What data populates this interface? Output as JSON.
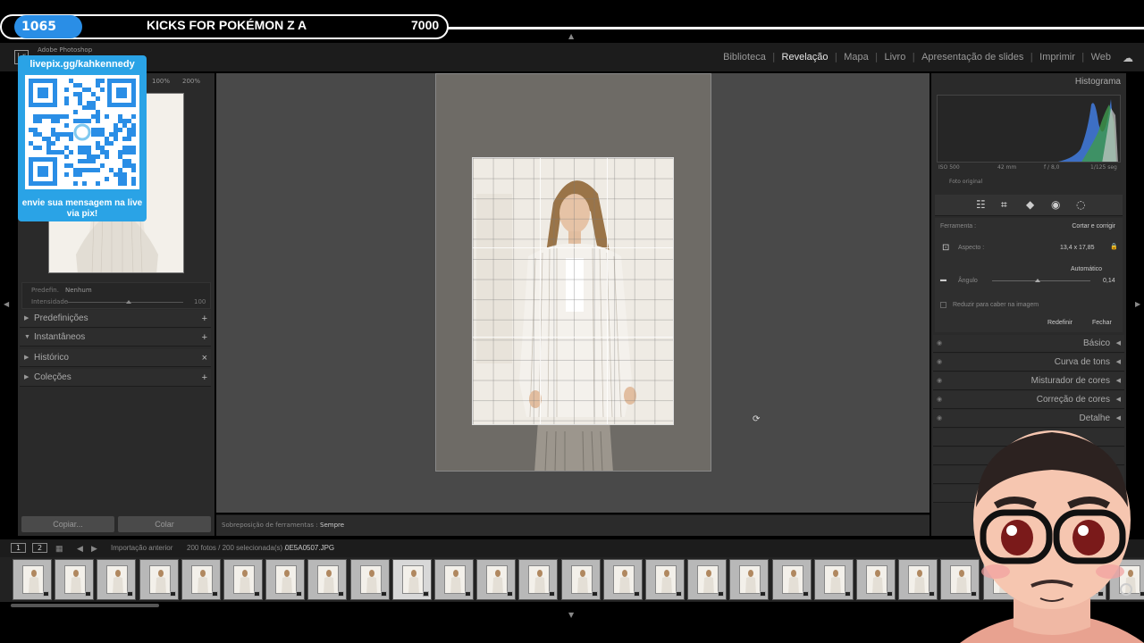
{
  "stream": {
    "count": "1065",
    "title": "KICKS FOR POKÉMON Z A",
    "value": "7000"
  },
  "app": {
    "name": "Adobe Photoshop",
    "logo": "Lr"
  },
  "modules": [
    "Biblioteca",
    "Revelação",
    "Mapa",
    "Livro",
    "Apresentação de slides",
    "Imprimir",
    "Web"
  ],
  "active_module": "Revelação",
  "left_panel": {
    "zoom_levels": [
      "100%",
      "200%"
    ],
    "preset_label": "Predefin.",
    "preset_value": "Nenhum",
    "intensity_label": "Intensidade",
    "intensity_value": "100",
    "sections": [
      {
        "label": "Predefinições",
        "action": "+",
        "open": false
      },
      {
        "label": "Instantâneos",
        "action": "+",
        "open": true
      },
      {
        "label": "Histórico",
        "action": "×",
        "open": false
      },
      {
        "label": "Coleções",
        "action": "+",
        "open": false
      }
    ],
    "copy_button": "Copiar...",
    "paste_button": "Colar"
  },
  "center": {
    "overlay_label": "Sobreposição de ferramentas :",
    "overlay_value": "Sempre"
  },
  "right_panel": {
    "histogram_title": "Histograma",
    "iso": "ISO 500",
    "focal": "42 mm",
    "aperture": "f / 8,0",
    "shutter": "1/125 seg",
    "original_photo": "Foto original",
    "tool_label": "Ferramenta :",
    "tool_value": "Cortar e corrigir",
    "aspect_label": "Aspecto :",
    "aspect_value": "13,4 x 17,85",
    "auto_label": "Automático",
    "angle_label": "Ângulo",
    "angle_value": "0,14",
    "constrain_label": "Reduzir para caber na imagem",
    "reset_button": "Redefinir",
    "close_button": "Fechar",
    "sections": [
      "Básico",
      "Curva de tons",
      "Misturador de cores",
      "Correção de cores",
      "Detalhe"
    ]
  },
  "filmstrip": {
    "page1": "1",
    "page2": "2",
    "source": "Importação anterior",
    "summary": "200 fotos / 200 selecionada(s) /",
    "filename": "0E5A0507.JPG"
  },
  "livepix": {
    "url": "livepix.gg/kahkennedy",
    "message": "envie sua mensagem na live via pix!"
  },
  "colors": {
    "accent_blue": "#2a8ee6",
    "livepix_blue": "#2aa3e6"
  }
}
